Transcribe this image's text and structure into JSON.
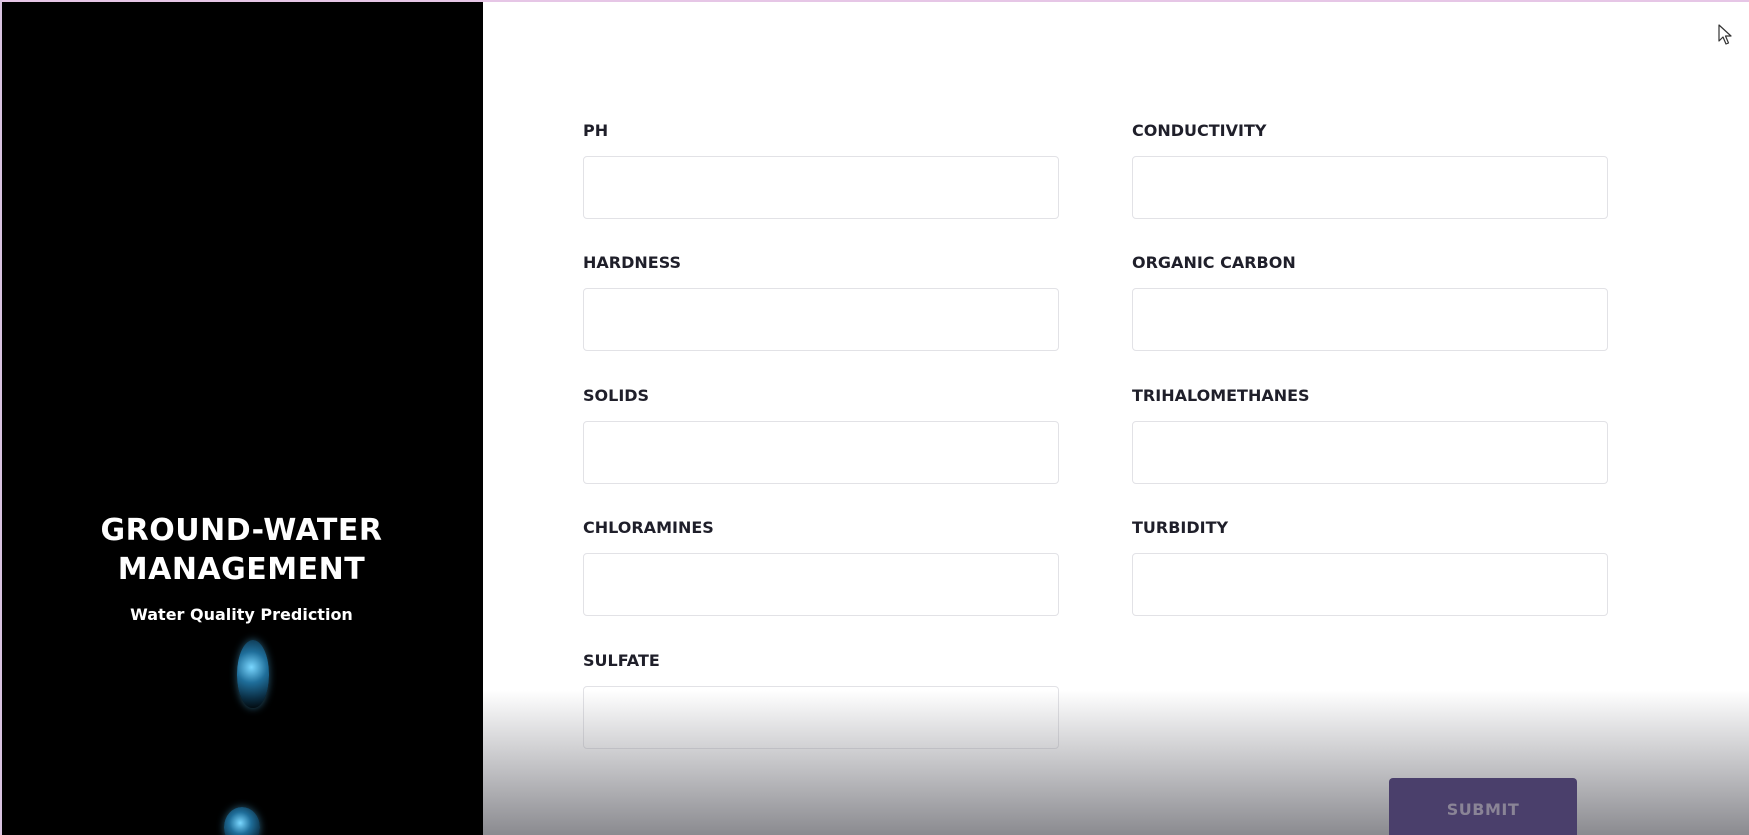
{
  "hero": {
    "title_line1": "GROUND-WATER",
    "title_line2": "MANAGEMENT",
    "subtitle": "Water Quality Prediction"
  },
  "form": {
    "fields": [
      {
        "label": "PH",
        "value": ""
      },
      {
        "label": "CONDUCTIVITY",
        "value": ""
      },
      {
        "label": "HARDNESS",
        "value": ""
      },
      {
        "label": "ORGANIC CARBON",
        "value": ""
      },
      {
        "label": "SOLIDS",
        "value": ""
      },
      {
        "label": "TRIHALOMETHANES",
        "value": ""
      },
      {
        "label": "CHLORAMINES",
        "value": ""
      },
      {
        "label": "TURBIDITY",
        "value": ""
      },
      {
        "label": "SULFATE",
        "value": ""
      }
    ],
    "submit_label": "SUBMIT"
  },
  "colors": {
    "hero_background": "#000000",
    "submit_background": "#4a3f6b",
    "label_text": "#1f1f2a"
  },
  "icons": [
    "water-droplet-icon",
    "mouse-cursor-icon"
  ]
}
